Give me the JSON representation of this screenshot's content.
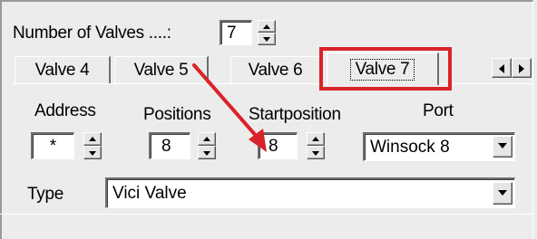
{
  "valves": {
    "count_label": "Number of Valves ....:",
    "count_value": "7"
  },
  "tabs": [
    {
      "label": "Valve 4",
      "active": false
    },
    {
      "label": "Valve 5",
      "active": false
    },
    {
      "label": "Valve 6",
      "active": false
    },
    {
      "label": "Valve 7",
      "active": true
    }
  ],
  "columns": {
    "address": "Address",
    "positions": "Positions",
    "startposition": "Startposition",
    "port": "Port"
  },
  "fields": {
    "address_value": "*",
    "positions_value": "8",
    "startposition_value": "8",
    "port_value": "Winsock 8",
    "type_label": "Type",
    "type_value": "Vici Valve"
  },
  "annotation": {
    "highlight_color": "#d9232b",
    "arrow_color": "#d9232b"
  }
}
